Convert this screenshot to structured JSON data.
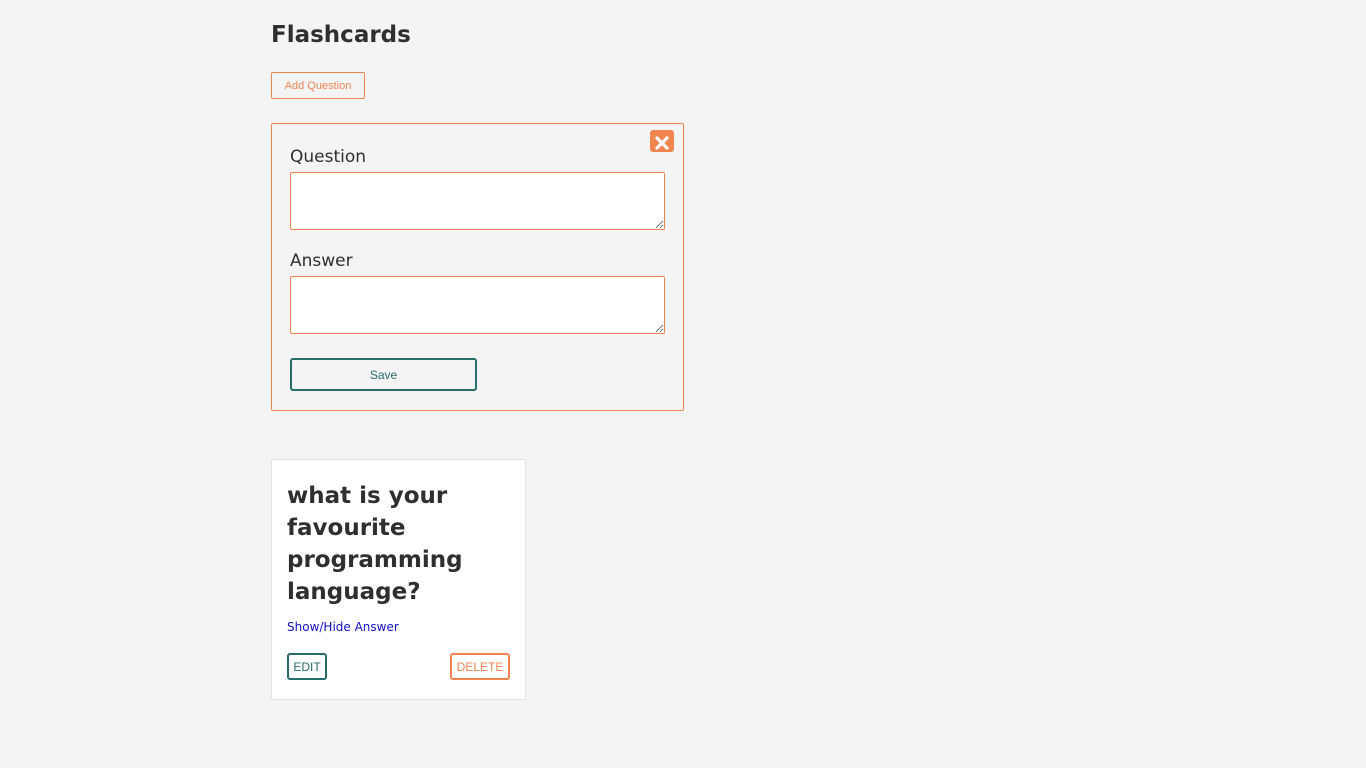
{
  "header": {
    "title": "Flashcards"
  },
  "toolbar": {
    "add_question_label": "Add Question"
  },
  "form": {
    "close_icon": "close-icon",
    "question_label": "Question",
    "question_value": "",
    "answer_label": "Answer",
    "answer_value": "",
    "save_label": "Save"
  },
  "cards": [
    {
      "question": "what is your favourite programming language?",
      "toggle_label": "Show/Hide Answer",
      "edit_label": "EDIT",
      "delete_label": "DELETE"
    }
  ],
  "colors": {
    "accent": "#f08550",
    "primary": "#266c69",
    "link": "#1010c8",
    "background": "#f4f4f4",
    "text": "#2f2f2f"
  }
}
